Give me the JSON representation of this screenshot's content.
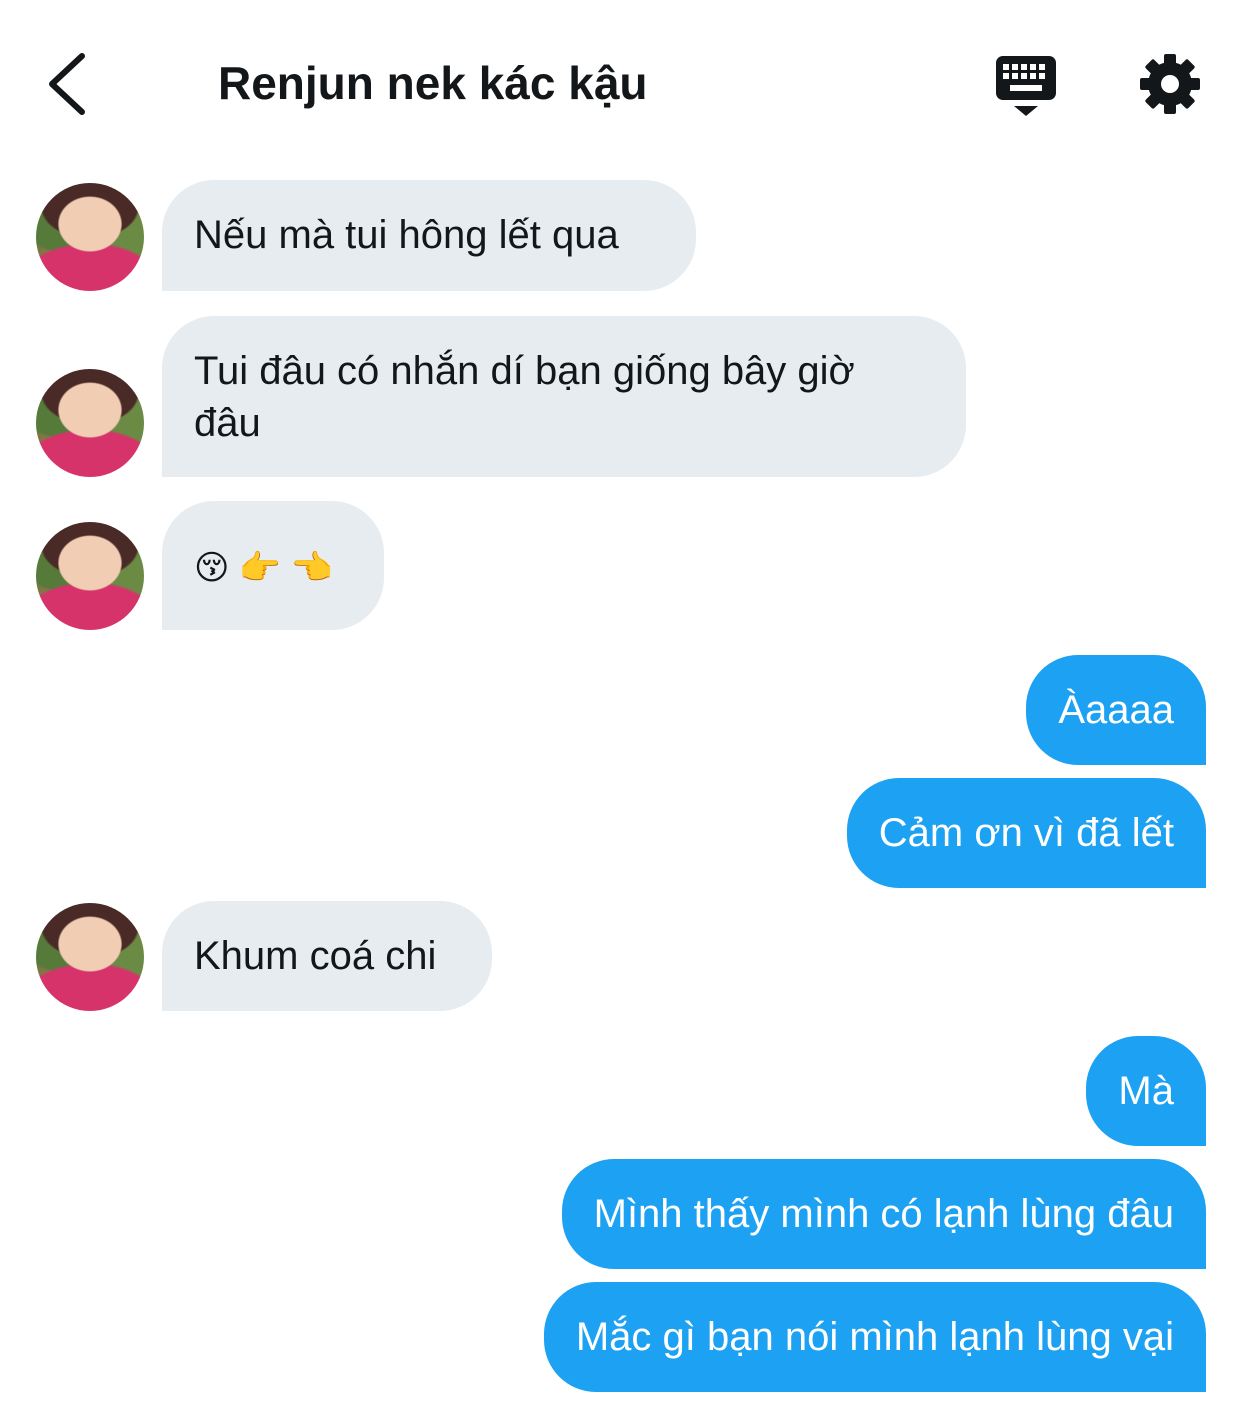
{
  "header": {
    "title": "Renjun nek kác kậu",
    "back_icon": "chevron-left-icon",
    "keyboard_icon": "keyboard-icon",
    "settings_icon": "gear-icon"
  },
  "messages": [
    {
      "side": "incoming",
      "text": "Nếu mà tui hông lết qua"
    },
    {
      "side": "incoming",
      "text": "Tui đâu có nhắn dí bạn giống bây giờ đâu"
    },
    {
      "side": "incoming",
      "text": "😚 👉 👈"
    },
    {
      "side": "outgoing",
      "text": "Àaaaa"
    },
    {
      "side": "outgoing",
      "text": "Cảm ơn vì đã lết"
    },
    {
      "side": "incoming",
      "text": "Khum coá chi"
    },
    {
      "side": "outgoing",
      "text": "Mà"
    },
    {
      "side": "outgoing",
      "text": "Mình thấy mình có lạnh lùng đâu"
    },
    {
      "side": "outgoing",
      "text": "Mắc gì bạn nói mình lạnh lùng vại"
    }
  ],
  "colors": {
    "incoming_bubble": "#e6ecf0",
    "outgoing_bubble": "#1da1f2",
    "text": "#14171a"
  }
}
